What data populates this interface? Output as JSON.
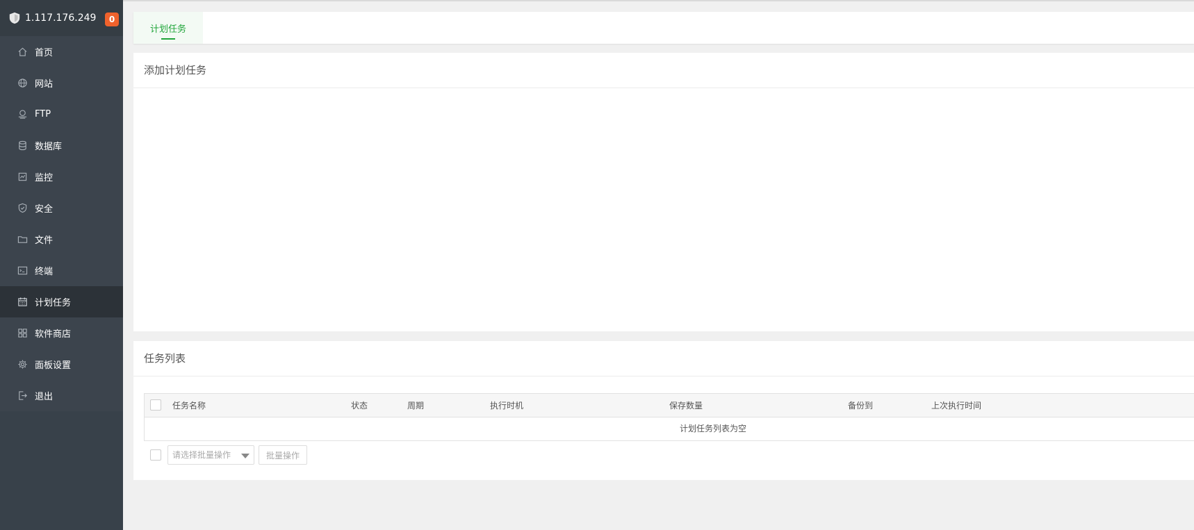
{
  "header": {
    "server_ip": "1.117.176.249",
    "notification_count": "0"
  },
  "sidebar": {
    "items": [
      {
        "label": "首页",
        "icon": "home-icon",
        "active": false
      },
      {
        "label": "网站",
        "icon": "globe-icon",
        "active": false
      },
      {
        "label": "FTP",
        "icon": "ftp-icon",
        "active": false
      },
      {
        "label": "数据库",
        "icon": "database-icon",
        "active": false
      },
      {
        "label": "监控",
        "icon": "monitor-icon",
        "active": false
      },
      {
        "label": "安全",
        "icon": "shield-check-icon",
        "active": false
      },
      {
        "label": "文件",
        "icon": "folder-icon",
        "active": false
      },
      {
        "label": "终端",
        "icon": "terminal-icon",
        "active": false
      },
      {
        "label": "计划任务",
        "icon": "calendar-icon",
        "active": true
      },
      {
        "label": "软件商店",
        "icon": "apps-grid-icon",
        "active": false
      },
      {
        "label": "面板设置",
        "icon": "gear-icon",
        "active": false
      },
      {
        "label": "退出",
        "icon": "logout-icon",
        "active": false
      }
    ]
  },
  "tabs": [
    {
      "label": "计划任务",
      "active": true
    }
  ],
  "add_panel": {
    "title": "添加计划任务"
  },
  "list_panel": {
    "title": "任务列表",
    "columns": [
      "任务名称",
      "状态",
      "周期",
      "执行时机",
      "保存数量",
      "备份到",
      "上次执行时间"
    ],
    "empty_text": "计划任务列表为空",
    "batch_select_placeholder": "请选择批量操作",
    "batch_button_label": "批量操作"
  },
  "colors": {
    "accent": "#20a53a",
    "sidebar_bg": "#3c444d",
    "sidebar_active": "#2c3238",
    "badge": "#f0622c"
  }
}
